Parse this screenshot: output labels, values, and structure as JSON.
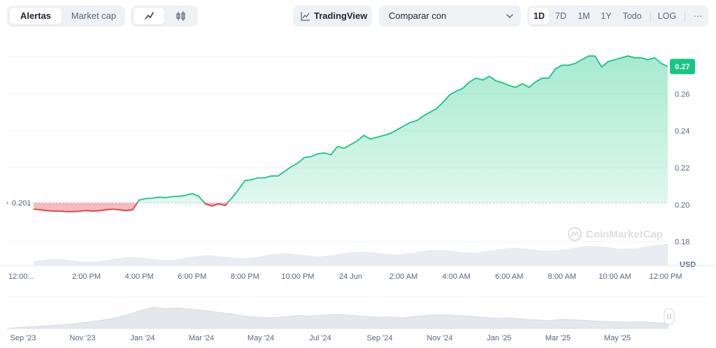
{
  "toolbar": {
    "tabs": [
      "Alertas",
      "Market cap"
    ],
    "tradingview": "TradingView",
    "compare": "Comparar con",
    "ranges": [
      "1D",
      "7D",
      "1M",
      "1Y",
      "Todo",
      "LOG"
    ],
    "more": "···"
  },
  "colors": {
    "up": "#16c784",
    "down": "#ea3943",
    "up_fill": "#16c784",
    "down_fill": "#ea3943"
  },
  "chart_data": {
    "type": "line",
    "title": "",
    "ylabel": "USD",
    "ylim": [
      0.167,
      0.29
    ],
    "baseline": 0.201,
    "baseline_label": "0.201",
    "current_price_label": "0.27",
    "y_ticks": [
      0.18,
      0.2,
      0.22,
      0.24,
      0.26
    ],
    "y_tick_labels": [
      "0.18",
      "0.20",
      "0.22",
      "0.24",
      "0.26"
    ],
    "x_tick_labels": [
      "12:00...",
      "2:00 PM",
      "4:00 PM",
      "6:00 PM",
      "8:00 PM",
      "10:00 PM",
      "24 Jun",
      "2:00 AM",
      "4:00 AM",
      "6:00 AM",
      "8:00 AM",
      "10:00 AM",
      "12:00 PM"
    ],
    "x_ticks_hours": [
      0,
      2,
      4,
      6,
      8,
      10,
      12,
      14,
      16,
      18,
      20,
      22,
      24
    ],
    "series": [
      {
        "x": [
          0,
          0.25,
          0.5,
          0.75,
          1.0,
          1.25,
          1.5,
          1.75,
          2.0,
          2.25,
          2.5,
          2.75,
          3.0,
          3.25,
          3.5,
          3.75,
          4.0,
          4.25,
          4.5,
          4.75,
          5.0,
          5.25,
          5.5,
          5.75,
          6.0,
          6.25,
          6.5,
          6.75,
          7.0,
          7.25,
          7.5,
          7.75,
          8.0,
          8.25,
          8.5,
          8.75,
          9.0,
          9.25,
          9.5,
          9.75,
          10.0,
          10.25,
          10.5,
          10.75,
          11.0,
          11.25,
          11.5,
          11.75,
          12.0,
          12.25,
          12.5,
          12.75,
          13.0,
          13.25,
          13.5,
          13.75,
          14.0,
          14.25,
          14.5,
          14.75,
          15.0,
          15.25,
          15.5,
          15.75,
          16.0,
          16.25,
          16.5,
          16.75,
          17.0,
          17.25,
          17.5,
          17.75,
          18.0,
          18.25,
          18.5,
          18.75,
          19.0,
          19.25,
          19.5,
          19.75,
          20.0,
          20.25,
          20.5,
          20.75,
          21.0,
          21.25,
          21.5,
          21.75,
          22.0,
          22.25,
          22.5,
          22.75,
          23.0,
          23.25,
          23.5,
          23.75,
          24.0
        ],
        "values": [
          0.1975,
          0.1972,
          0.1968,
          0.1965,
          0.1965,
          0.1962,
          0.1962,
          0.1965,
          0.1968,
          0.1965,
          0.1968,
          0.1972,
          0.1975,
          0.1972,
          0.1968,
          0.1972,
          0.2025,
          0.2033,
          0.2035,
          0.204,
          0.2038,
          0.2043,
          0.2045,
          0.205,
          0.206,
          0.2045,
          0.2005,
          0.1992,
          0.2005,
          0.1995,
          0.2035,
          0.208,
          0.213,
          0.2135,
          0.2145,
          0.2145,
          0.2155,
          0.2155,
          0.218,
          0.2205,
          0.2225,
          0.2255,
          0.226,
          0.2275,
          0.228,
          0.227,
          0.2315,
          0.2305,
          0.2325,
          0.2345,
          0.2375,
          0.2355,
          0.2365,
          0.2375,
          0.2385,
          0.2405,
          0.2425,
          0.2445,
          0.2455,
          0.248,
          0.25,
          0.252,
          0.2555,
          0.2595,
          0.2615,
          0.263,
          0.2665,
          0.2685,
          0.2675,
          0.2695,
          0.267,
          0.266,
          0.2645,
          0.2635,
          0.2655,
          0.2635,
          0.2665,
          0.2685,
          0.2685,
          0.2735,
          0.2755,
          0.2755,
          0.2765,
          0.2785,
          0.2805,
          0.2805,
          0.2745,
          0.2775,
          0.2785,
          0.2795,
          0.2805,
          0.2795,
          0.2795,
          0.2785,
          0.2795,
          0.2765,
          0.2748
        ]
      }
    ],
    "volume_style": "gray area at bottom"
  },
  "navigator": {
    "labels": [
      "Sep '23",
      "Nov '23",
      "Jan '24",
      "Mar '24",
      "May '24",
      "Jul '24",
      "Sep '24",
      "Nov '24",
      "Jan '25",
      "Mar '25",
      "May '25"
    ],
    "volume": [
      0,
      0.05,
      0.08,
      0.12,
      0.15,
      0.2,
      0.28,
      0.35,
      0.45,
      0.6,
      0.78,
      0.95,
      0.88,
      0.92,
      0.85,
      0.8,
      0.72,
      0.65,
      0.55,
      0.5,
      0.48,
      0.52,
      0.58,
      0.55,
      0.6,
      0.63,
      0.58,
      0.55,
      0.5,
      0.52,
      0.48,
      0.55,
      0.6,
      0.62,
      0.58,
      0.55,
      0.5,
      0.45,
      0.48,
      0.42,
      0.38,
      0.35,
      0.4,
      0.38,
      0.35,
      0.32,
      0.3,
      0.28,
      0.3,
      0.26,
      0.22
    ]
  },
  "watermark": "CoinMarketCap"
}
